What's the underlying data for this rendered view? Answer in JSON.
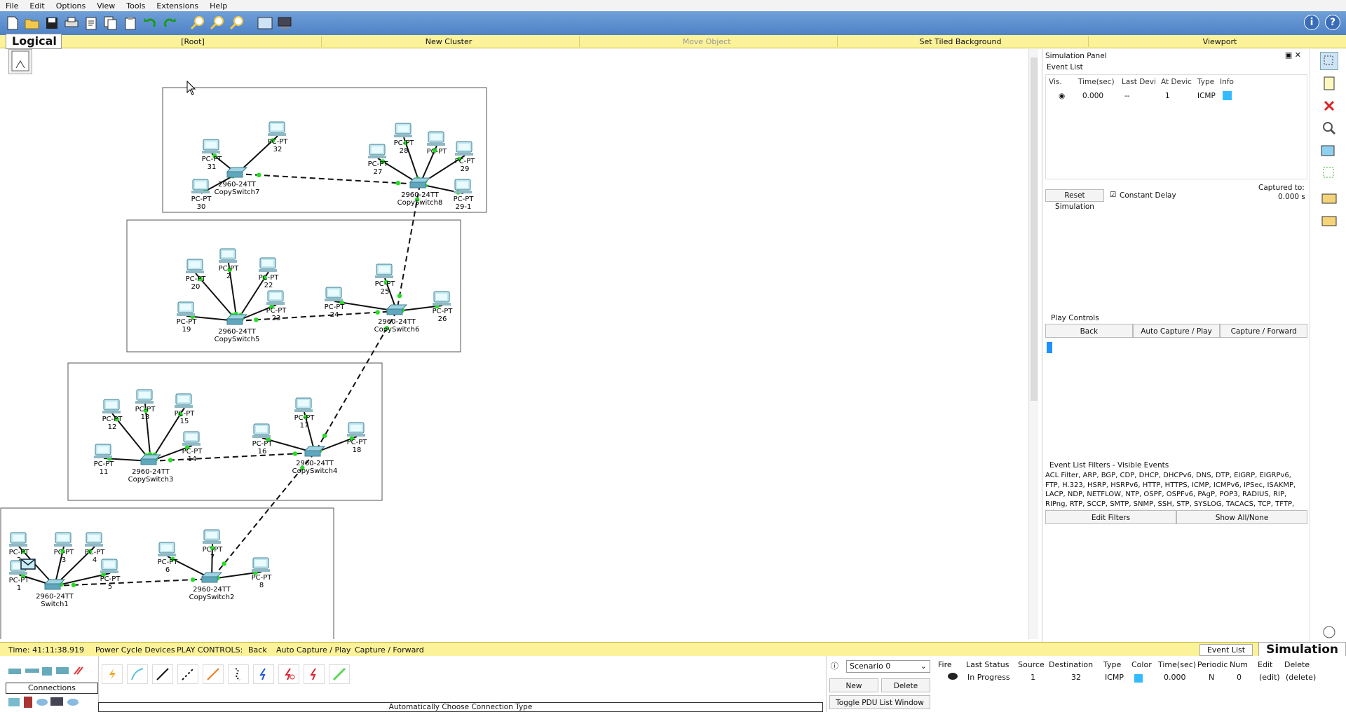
{
  "menu": [
    "File",
    "Edit",
    "Options",
    "View",
    "Tools",
    "Extensions",
    "Help"
  ],
  "logical_bar": {
    "title": "Logical",
    "root": "[Root]",
    "new_cluster": "New Cluster",
    "move_object": "Move Object",
    "set_tiled_background": "Set Tiled Background",
    "viewport": "Viewport"
  },
  "devices": [
    {
      "type": "PC-PT",
      "name": "31"
    },
    {
      "type": "PC-PT",
      "name": "32"
    },
    {
      "type": "PC-PT",
      "name": "30"
    },
    {
      "type": "PC-PT",
      "name": "28"
    },
    {
      "type": "PC-PT",
      "name": "27"
    },
    {
      "type": "PC-PT",
      "name": "29"
    },
    {
      "type": "PC-PT",
      "name": "29-1"
    },
    {
      "type": "PC-PT",
      "name": ""
    },
    {
      "type": "PC-PT",
      "name": "20"
    },
    {
      "type": "PC-PT",
      "name": "2"
    },
    {
      "type": "PC-PT",
      "name": "22"
    },
    {
      "type": "PC-PT",
      "name": "23"
    },
    {
      "type": "PC-PT",
      "name": "19"
    },
    {
      "type": "PC-PT",
      "name": "24"
    },
    {
      "type": "PC-PT",
      "name": "25"
    },
    {
      "type": "PC-PT",
      "name": "26"
    },
    {
      "type": "PC-PT",
      "name": "12"
    },
    {
      "type": "PC-PT",
      "name": "13"
    },
    {
      "type": "PC-PT",
      "name": "15"
    },
    {
      "type": "PC-PT",
      "name": "14"
    },
    {
      "type": "PC-PT",
      "name": "11"
    },
    {
      "type": "PC-PT",
      "name": "16"
    },
    {
      "type": "PC-PT",
      "name": "17"
    },
    {
      "type": "PC-PT",
      "name": "18"
    },
    {
      "type": "PC-PT",
      "name": "2"
    },
    {
      "type": "PC-PT",
      "name": "3"
    },
    {
      "type": "PC-PT",
      "name": "4"
    },
    {
      "type": "PC-PT",
      "name": "5"
    },
    {
      "type": "PC-PT",
      "name": "1"
    },
    {
      "type": "PC-PT",
      "name": "6"
    },
    {
      "type": "PC-PT",
      "name": "7"
    },
    {
      "type": "PC-PT",
      "name": "8"
    }
  ],
  "switches": [
    {
      "model": "2960-24TT",
      "name": "CopySwitch7"
    },
    {
      "model": "2960-24TT",
      "name": "CopySwitch8"
    },
    {
      "model": "2960-24TT",
      "name": "CopySwitch5"
    },
    {
      "model": "2960-24TT",
      "name": "CopySwitch6"
    },
    {
      "model": "2960-24TT",
      "name": "CopySwitch3"
    },
    {
      "model": "2960-24TT",
      "name": "CopySwitch4"
    },
    {
      "model": "2960-24TT",
      "name": "Switch1"
    },
    {
      "model": "2960-24TT",
      "name": "CopySwitch2"
    }
  ],
  "sim_panel": {
    "title": "Simulation Panel",
    "event_list_label": "Event List",
    "columns": [
      "Vis.",
      "Time(sec)",
      "Last Devi",
      "At Devic",
      "Type",
      "Info"
    ],
    "event": {
      "time": "0.000",
      "last_device": "--",
      "at_device": "1",
      "type": "ICMP"
    },
    "reset_simulation": "Reset Simulation",
    "constant_delay": "Constant Delay",
    "captured_to_label": "Captured to:",
    "captured_to_value": "0.000 s",
    "play_controls_label": "Play Controls",
    "back": "Back",
    "auto_capture_play": "Auto Capture / Play",
    "capture_forward": "Capture / Forward",
    "filters_label": "Event List Filters - Visible Events",
    "filters_text": "ACL Filter, ARP, BGP, CDP, DHCP, DHCPv6, DNS, DTP, EIGRP, EIGRPv6, FTP, H.323, HSRP, HSRPv6, HTTP, HTTPS, ICMP, ICMPv6, IPSec, ISAKMP, LACP, NDP, NETFLOW, NTP, OSPF, OSPFv6, PAgP, POP3, RADIUS, RIP, RIPng, RTP, SCCP, SMTP, SNMP, SSH, STP, SYSLOG, TACACS, TCP, TFTP, Telnet, UDP, VTP",
    "edit_filters": "Edit Filters",
    "show_all_none": "Show All/None"
  },
  "status_bar": {
    "time": "Time: 41:11:38.919",
    "power_cycle": "Power Cycle Devices",
    "play_controls": "PLAY CONTROLS:",
    "back": "Back",
    "auto_capture_play": "Auto Capture / Play",
    "capture_forward": "Capture / Forward",
    "event_list_tab": "Event List",
    "simulation_tab": "Simulation"
  },
  "bottom": {
    "connections_label": "Connections",
    "conn_caption": "Automatically Choose Connection Type",
    "scenario": "Scenario 0",
    "new": "New",
    "delete": "Delete",
    "toggle_pdu": "Toggle PDU List Window",
    "pdu_headers": [
      "Fire",
      "Last Status",
      "Source",
      "Destination",
      "Type",
      "Color",
      "Time(sec)",
      "Periodic",
      "Num",
      "Edit",
      "Delete"
    ],
    "pdu_row": {
      "status": "In Progress",
      "source": "1",
      "destination": "32",
      "type": "ICMP",
      "time": "0.000",
      "periodic": "N",
      "num": "0",
      "edit": "(edit)",
      "delete": "(delete)"
    }
  },
  "colors": {
    "link_green": "#22dd22",
    "event_color": "#33bbff",
    "yellow_bar": "#fbf29a",
    "toolbar_blue": "#5a8ccc"
  }
}
